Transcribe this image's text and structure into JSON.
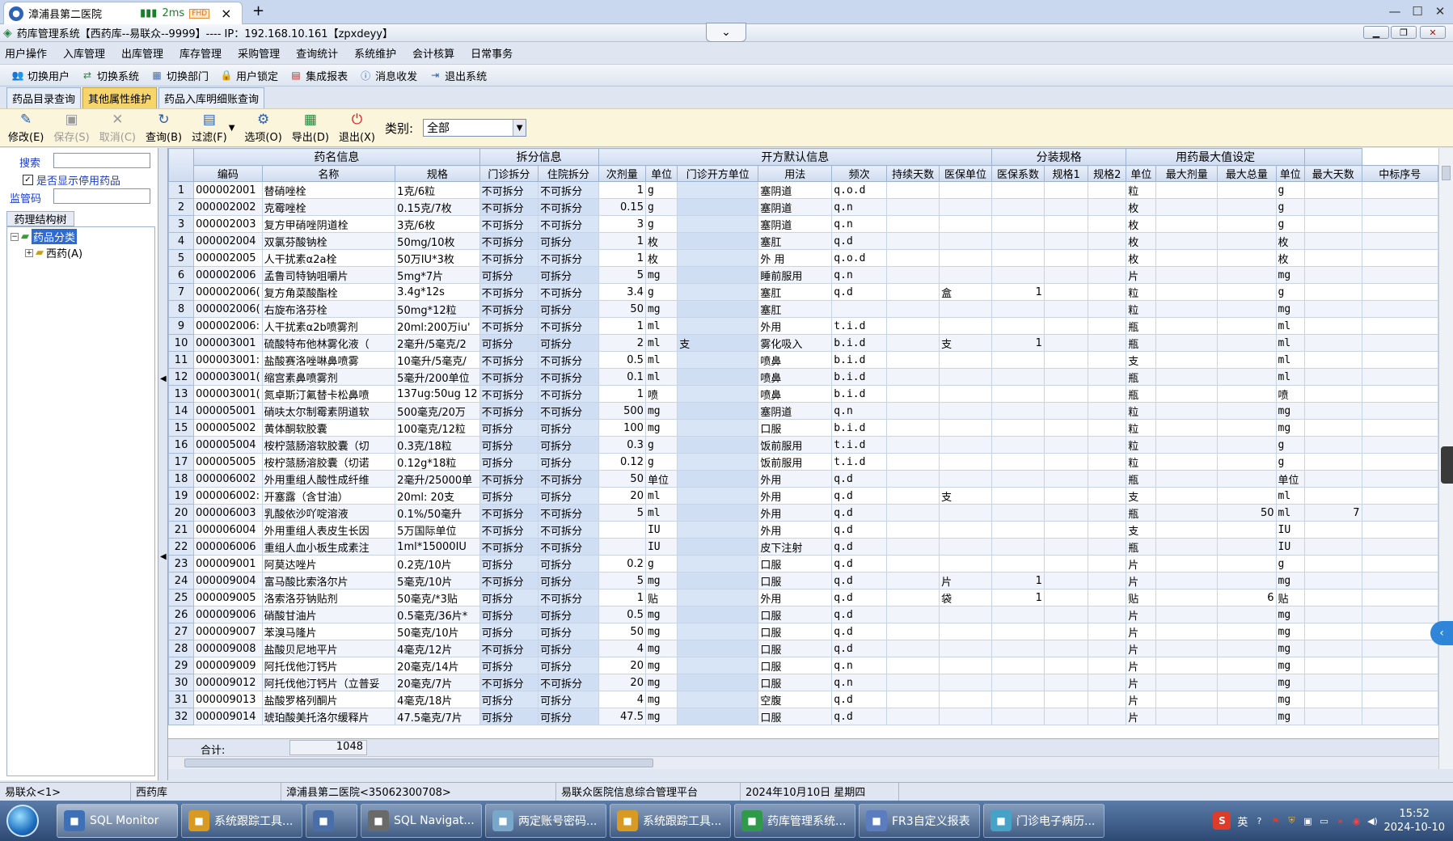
{
  "browser": {
    "tab_title": "漳浦县第二医院",
    "ping": "2ms",
    "chip": "FHD",
    "close": "×",
    "newtab": "+"
  },
  "app": {
    "title": "药库管理系统【西药库--易联众--9999】---- IP：192.168.10.161【zpxdeyy】",
    "dropdown": "⌄"
  },
  "menu": [
    "用户操作",
    "入库管理",
    "出库管理",
    "库存管理",
    "采购管理",
    "查询统计",
    "系统维护",
    "会计核算",
    "日常事务"
  ],
  "toolbar": [
    "切换用户",
    "切换系统",
    "切换部门",
    "用户锁定",
    "集成报表",
    "消息收发",
    "退出系统"
  ],
  "doc_tabs": [
    "药品目录查询",
    "其他属性维护",
    "药品入库明细账查询"
  ],
  "actions": [
    {
      "label": "修改(E)",
      "icon": "edit-icon",
      "enabled": true
    },
    {
      "label": "保存(S)",
      "icon": "save-icon",
      "enabled": false
    },
    {
      "label": "取消(C)",
      "icon": "cancel-icon",
      "enabled": false
    },
    {
      "label": "查询(B)",
      "icon": "refresh-icon",
      "enabled": true
    },
    {
      "label": "过滤(F)",
      "icon": "filter-icon",
      "enabled": true
    },
    {
      "label": "选项(O)",
      "icon": "options-icon",
      "enabled": true
    },
    {
      "label": "导出(D)",
      "icon": "excel-icon",
      "enabled": true
    },
    {
      "label": "退出(X)",
      "icon": "power-icon",
      "enabled": true
    }
  ],
  "category": {
    "label": "类别:",
    "value": "全部"
  },
  "left": {
    "search_label": "搜索",
    "show_disabled": "是否显示停用药品",
    "supervise_label": "监管码",
    "tree_tab": "药理结构树",
    "tree_root": "药品分类",
    "tree_child": "西药(A)"
  },
  "grid": {
    "groups": [
      {
        "label": "药名信息",
        "span": 3
      },
      {
        "label": "拆分信息",
        "span": 2
      },
      {
        "label": "开方默认信息",
        "span": 7
      },
      {
        "label": "分装规格",
        "span": 3
      },
      {
        "label": "用药最大值设定",
        "span": 4
      },
      {
        "label": "",
        "span": 1
      }
    ],
    "columns": [
      "编码",
      "名称",
      "规格",
      "门诊拆分",
      "住院拆分",
      "次剂量",
      "单位",
      "门诊开方单位",
      "用法",
      "频次",
      "持续天数",
      "医保单位",
      "医保系数",
      "规格1",
      "规格2",
      "单位",
      "最大剂量",
      "最大总量",
      "单位",
      "最大天数",
      "中标序号"
    ],
    "rows": [
      [
        "1",
        "000002001",
        "替硝唑栓",
        "1克/6粒",
        "不可拆分",
        "不可拆分",
        "1",
        "g",
        "",
        "塞阴道",
        "q.o.d",
        "",
        "",
        "",
        "",
        "",
        "粒",
        "",
        "",
        "g",
        "",
        ""
      ],
      [
        "2",
        "000002002",
        "克霉唑栓",
        "0.15克/7枚",
        "不可拆分",
        "不可拆分",
        "0.15",
        "g",
        "",
        "塞阴道",
        "q.n",
        "",
        "",
        "",
        "",
        "",
        "枚",
        "",
        "",
        "g",
        "",
        ""
      ],
      [
        "3",
        "000002003",
        "复方甲硝唑阴道栓",
        "3克/6枚",
        "不可拆分",
        "不可拆分",
        "3",
        "g",
        "",
        "塞阴道",
        "q.n",
        "",
        "",
        "",
        "",
        "",
        "枚",
        "",
        "",
        "g",
        "",
        ""
      ],
      [
        "4",
        "000002004",
        "双氯芬酸钠栓",
        "50mg/10枚",
        "不可拆分",
        "可拆分",
        "1",
        "枚",
        "",
        "塞肛",
        "q.d",
        "",
        "",
        "",
        "",
        "",
        "枚",
        "",
        "",
        "枚",
        "",
        ""
      ],
      [
        "5",
        "000002005",
        "人干扰素α2a栓",
        "50万IU*3枚",
        "不可拆分",
        "不可拆分",
        "1",
        "枚",
        "",
        "外 用",
        "q.o.d",
        "",
        "",
        "",
        "",
        "",
        "枚",
        "",
        "",
        "枚",
        "",
        ""
      ],
      [
        "6",
        "000002006",
        "孟鲁司特钠咀嚼片",
        "5mg*7片",
        "可拆分",
        "可拆分",
        "5",
        "mg",
        "",
        "睡前服用",
        "q.n",
        "",
        "",
        "",
        "",
        "",
        "片",
        "",
        "",
        "mg",
        "",
        ""
      ],
      [
        "7",
        "000002006(",
        "复方角菜酸酯栓",
        "3.4g*12s",
        "不可拆分",
        "不可拆分",
        "3.4",
        "g",
        "",
        "塞肛",
        "q.d",
        "",
        "盒",
        "1",
        "",
        "",
        "粒",
        "",
        "",
        "g",
        "",
        ""
      ],
      [
        "8",
        "000002006(",
        "右旋布洛芬栓",
        "50mg*12粒",
        "不可拆分",
        "可拆分",
        "50",
        "mg",
        "",
        "塞肛",
        "",
        "",
        "",
        "",
        "",
        "",
        "粒",
        "",
        "",
        "mg",
        "",
        ""
      ],
      [
        "9",
        "000002006:",
        "人干扰素α2b喷雾剂",
        "20ml:200万iu'",
        "不可拆分",
        "不可拆分",
        "1",
        "ml",
        "",
        "外用",
        "t.i.d",
        "",
        "",
        "",
        "",
        "",
        "瓶",
        "",
        "",
        "ml",
        "",
        ""
      ],
      [
        "10",
        "000003001",
        "硫酸特布他林雾化液（",
        "2毫升/5毫克/2",
        "可拆分",
        "可拆分",
        "2",
        "ml",
        "支",
        "雾化吸入",
        "b.i.d",
        "",
        "支",
        "1",
        "",
        "",
        "瓶",
        "",
        "",
        "ml",
        "",
        ""
      ],
      [
        "11",
        "000003001:",
        "盐酸赛洛唑啉鼻喷雾",
        "10毫升/5毫克/",
        "不可拆分",
        "不可拆分",
        "0.5",
        "ml",
        "",
        "喷鼻",
        "b.i.d",
        "",
        "",
        "",
        "",
        "",
        "支",
        "",
        "",
        "ml",
        "",
        ""
      ],
      [
        "12",
        "000003001(",
        "缩宫素鼻喷雾剂",
        "5毫升/200单位",
        "不可拆分",
        "不可拆分",
        "0.1",
        "ml",
        "",
        "喷鼻",
        "b.i.d",
        "",
        "",
        "",
        "",
        "",
        "瓶",
        "",
        "",
        "ml",
        "",
        ""
      ],
      [
        "13",
        "000003001(",
        "氮卓斯汀氟替卡松鼻喷",
        "137ug:50ug 12",
        "不可拆分",
        "不可拆分",
        "1",
        "喷",
        "",
        "喷鼻",
        "b.i.d",
        "",
        "",
        "",
        "",
        "",
        "瓶",
        "",
        "",
        "喷",
        "",
        ""
      ],
      [
        "14",
        "000005001",
        "硝呋太尔制霉素阴道软",
        "500毫克/20万",
        "不可拆分",
        "不可拆分",
        "500",
        "mg",
        "",
        "塞阴道",
        "q.n",
        "",
        "",
        "",
        "",
        "",
        "粒",
        "",
        "",
        "mg",
        "",
        ""
      ],
      [
        "15",
        "000005002",
        "黄体酮软胶囊",
        "100毫克/12粒",
        "可拆分",
        "可拆分",
        "100",
        "mg",
        "",
        "口服",
        "b.i.d",
        "",
        "",
        "",
        "",
        "",
        "粒",
        "",
        "",
        "mg",
        "",
        ""
      ],
      [
        "16",
        "000005004",
        "桉柠蒎肠溶软胶囊（切",
        "0.3克/18粒",
        "可拆分",
        "可拆分",
        "0.3",
        "g",
        "",
        "饭前服用",
        "t.i.d",
        "",
        "",
        "",
        "",
        "",
        "粒",
        "",
        "",
        "g",
        "",
        ""
      ],
      [
        "17",
        "000005005",
        "桉柠蒎肠溶胶囊（切诺",
        "0.12g*18粒",
        "可拆分",
        "可拆分",
        "0.12",
        "g",
        "",
        "饭前服用",
        "t.i.d",
        "",
        "",
        "",
        "",
        "",
        "粒",
        "",
        "",
        "g",
        "",
        ""
      ],
      [
        "18",
        "000006002",
        "外用重组人酸性成纤维",
        "2毫升/25000单",
        "不可拆分",
        "不可拆分",
        "50",
        "单位",
        "",
        "外用",
        "q.d",
        "",
        "",
        "",
        "",
        "",
        "瓶",
        "",
        "",
        "单位",
        "",
        ""
      ],
      [
        "19",
        "000006002:",
        "开塞露（含甘油）",
        "20ml: 20支",
        "可拆分",
        "可拆分",
        "20",
        "ml",
        "",
        "外用",
        "q.d",
        "",
        "支",
        "",
        "",
        "",
        "支",
        "",
        "",
        "ml",
        "",
        ""
      ],
      [
        "20",
        "000006003",
        "乳酸依沙吖啶溶液",
        "0.1%/50毫升",
        "不可拆分",
        "不可拆分",
        "5",
        "ml",
        "",
        "外用",
        "q.d",
        "",
        "",
        "",
        "",
        "",
        "瓶",
        "",
        "50",
        "ml",
        "7",
        ""
      ],
      [
        "21",
        "000006004",
        "外用重组人表皮生长因",
        "5万国际单位",
        "不可拆分",
        "不可拆分",
        "",
        "IU",
        "",
        "外用",
        "q.d",
        "",
        "",
        "",
        "",
        "",
        "支",
        "",
        "",
        "IU",
        "",
        ""
      ],
      [
        "22",
        "000006006",
        "重组人血小板生成素注",
        "1ml*15000IU",
        "不可拆分",
        "不可拆分",
        "",
        "IU",
        "",
        "皮下注射",
        "q.d",
        "",
        "",
        "",
        "",
        "",
        "瓶",
        "",
        "",
        "IU",
        "",
        ""
      ],
      [
        "23",
        "000009001",
        "阿莫达唑片",
        "0.2克/10片",
        "可拆分",
        "可拆分",
        "0.2",
        "g",
        "",
        "口服",
        "q.d",
        "",
        "",
        "",
        "",
        "",
        "片",
        "",
        "",
        "g",
        "",
        ""
      ],
      [
        "24",
        "000009004",
        "富马酸比索洛尔片",
        "5毫克/10片",
        "不可拆分",
        "可拆分",
        "5",
        "mg",
        "",
        "口服",
        "q.d",
        "",
        "片",
        "1",
        "",
        "",
        "片",
        "",
        "",
        "mg",
        "",
        ""
      ],
      [
        "25",
        "000009005",
        "洛索洛芬钠贴剂",
        "50毫克/*3贴",
        "可拆分",
        "不可拆分",
        "1",
        "贴",
        "",
        "外用",
        "q.d",
        "",
        "袋",
        "1",
        "",
        "",
        "贴",
        "",
        "6",
        "贴",
        "",
        ""
      ],
      [
        "26",
        "000009006",
        "硝酸甘油片",
        "0.5毫克/36片*",
        "可拆分",
        "可拆分",
        "0.5",
        "mg",
        "",
        "口服",
        "q.d",
        "",
        "",
        "",
        "",
        "",
        "片",
        "",
        "",
        "mg",
        "",
        ""
      ],
      [
        "27",
        "000009007",
        "苯溴马隆片",
        "50毫克/10片",
        "可拆分",
        "可拆分",
        "50",
        "mg",
        "",
        "口服",
        "q.d",
        "",
        "",
        "",
        "",
        "",
        "片",
        "",
        "",
        "mg",
        "",
        ""
      ],
      [
        "28",
        "000009008",
        "盐酸贝尼地平片",
        "4毫克/12片",
        "不可拆分",
        "可拆分",
        "4",
        "mg",
        "",
        "口服",
        "q.d",
        "",
        "",
        "",
        "",
        "",
        "片",
        "",
        "",
        "mg",
        "",
        ""
      ],
      [
        "29",
        "000009009",
        "阿托伐他汀钙片",
        "20毫克/14片",
        "可拆分",
        "可拆分",
        "20",
        "mg",
        "",
        "口服",
        "q.n",
        "",
        "",
        "",
        "",
        "",
        "片",
        "",
        "",
        "mg",
        "",
        ""
      ],
      [
        "30",
        "000009012",
        "阿托伐他汀钙片（立普妥",
        "20毫克/7片",
        "不可拆分",
        "不可拆分",
        "20",
        "mg",
        "",
        "口服",
        "q.n",
        "",
        "",
        "",
        "",
        "",
        "片",
        "",
        "",
        "mg",
        "",
        ""
      ],
      [
        "31",
        "000009013",
        "盐酸罗格列酮片",
        "4毫克/18片",
        "可拆分",
        "可拆分",
        "4",
        "mg",
        "",
        "空腹",
        "q.d",
        "",
        "",
        "",
        "",
        "",
        "片",
        "",
        "",
        "mg",
        "",
        ""
      ],
      [
        "32",
        "000009014",
        "琥珀酸美托洛尔缓释片",
        "47.5毫克/7片",
        "可拆分",
        "可拆分",
        "47.5",
        "mg",
        "",
        "口服",
        "q.d",
        "",
        "",
        "",
        "",
        "",
        "片",
        "",
        "",
        "mg",
        "",
        ""
      ]
    ],
    "total_label": "合计:",
    "total_value": "1048"
  },
  "status": {
    "user": "易联众<1>",
    "dept": "西药库",
    "hospital": "漳浦县第二医院<35062300708>",
    "platform": "易联众医院信息综合管理平台",
    "date": "2024年10月10日 星期四"
  },
  "taskbar": {
    "apps": [
      {
        "label": "SQL Monitor",
        "icon": "sql-monitor-icon",
        "color": "#3f6fb5",
        "active": true
      },
      {
        "label": "系统跟踪工具...",
        "icon": "sql-trace-icon",
        "color": "#d89a23"
      },
      {
        "label": "",
        "icon": "network-icon",
        "color": "#4a6fa8"
      },
      {
        "label": "SQL Navigat...",
        "icon": "sql-navigator-icon",
        "color": "#6a6a6a"
      },
      {
        "label": "两定账号密码...",
        "icon": "notepad-icon",
        "color": "#79a7c9"
      },
      {
        "label": "系统跟踪工具...",
        "icon": "sql-trace-icon",
        "color": "#d89a23"
      },
      {
        "label": "药库管理系统...",
        "icon": "pharmacy-icon",
        "color": "#2e9a4a"
      },
      {
        "label": "FR3自定义报表",
        "icon": "report-icon",
        "color": "#5b7dc0"
      },
      {
        "label": "门诊电子病历...",
        "icon": "emr-icon",
        "color": "#46a3c7"
      }
    ],
    "ime": "英",
    "time": "15:52",
    "date": "2024-10-10"
  }
}
